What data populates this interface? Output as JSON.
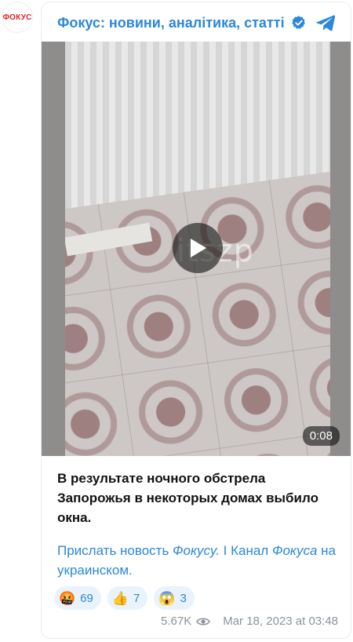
{
  "channel": {
    "avatar_text": "ФОКУС",
    "name": "Фокус: новини, аналітика, статті",
    "verified_icon": "verified-check-icon",
    "telegram_icon": "telegram-icon"
  },
  "video": {
    "watermark": "itszp",
    "duration": "0:08",
    "play_icon": "play-icon"
  },
  "message": {
    "text": "В результате ночного обстрела Запорожья в некоторых домах выбило окна."
  },
  "links": {
    "send_news_prefix": "Прислать новость ",
    "send_news_brand": "Фокусу.",
    "separator": " I ",
    "channel_prefix": "Канал ",
    "channel_brand": "Фокуса",
    "channel_suffix": " на украинском."
  },
  "reactions": [
    {
      "emoji": "🤬",
      "count": "69"
    },
    {
      "emoji": "👍",
      "count": "7"
    },
    {
      "emoji": "😱",
      "count": "3"
    }
  ],
  "meta": {
    "views": "5.67K",
    "views_icon": "eye-icon",
    "date": "Mar 18, 2023 at 03:48"
  },
  "colors": {
    "accent": "#2b88d9",
    "brand_red": "#e0232a",
    "muted": "#8a949e"
  }
}
